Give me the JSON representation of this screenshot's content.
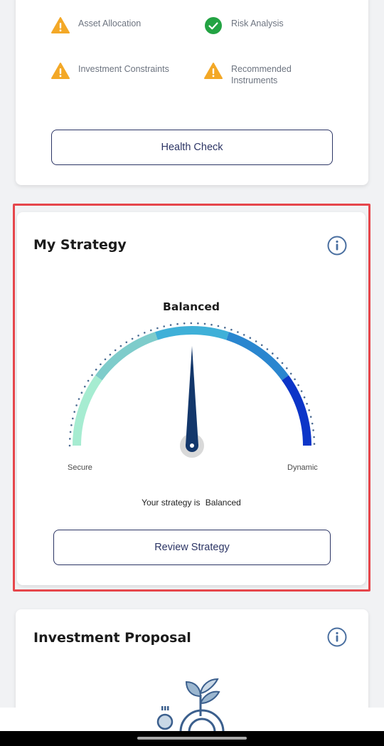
{
  "health": {
    "items": [
      {
        "label": "Asset Allocation",
        "status": "warning",
        "icon": "warning-icon"
      },
      {
        "label": "Risk Analysis",
        "status": "ok",
        "icon": "check-circle-icon"
      },
      {
        "label": "Investment Constraints",
        "status": "warning",
        "icon": "warning-icon"
      },
      {
        "label": "Recommended Instruments",
        "status": "warning",
        "icon": "warning-icon"
      }
    ],
    "button_label": "Health Check"
  },
  "strategy": {
    "title": "My Strategy",
    "gauge_title": "Balanced",
    "min_label": "Secure",
    "max_label": "Dynamic",
    "needle_position": 0.5,
    "summary_prefix": "Your strategy is",
    "summary_value": "Balanced",
    "button_label": "Review Strategy"
  },
  "proposal": {
    "title": "Investment Proposal"
  },
  "colors": {
    "warning": "#f3a827",
    "ok": "#23a343",
    "primary": "#2c3565",
    "highlight": "#e6464b",
    "gauge_segments": [
      "#a6ecd1",
      "#7ecccb",
      "#3fb0d8",
      "#2a86cf",
      "#0c35c8"
    ],
    "needle": "#13376b"
  }
}
